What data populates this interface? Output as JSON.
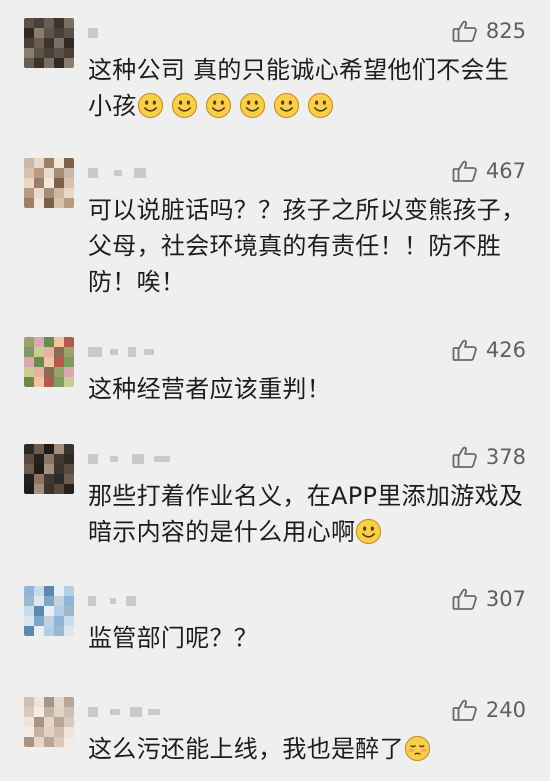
{
  "comments": [
    {
      "likes": "825",
      "text": "这种公司 真的只能诚心希望他们不会生小孩",
      "emojis": [
        "smile",
        "smile",
        "smile",
        "smile",
        "smile",
        "smile"
      ],
      "avatar_colors": [
        "#5a5248",
        "#4a3f34",
        "#6a5e52",
        "#3c332b",
        "#7b6f63",
        "#2f2a25",
        "#8a7d70",
        "#5e5348",
        "#47403a"
      ]
    },
    {
      "likes": "467",
      "text": "可以说脏话吗？？孩子之所以变熊孩子，父母，社会环境真的有责任！！防不胜防！唉！",
      "emojis": [],
      "avatar_colors": [
        "#c9b8a8",
        "#e7d8c8",
        "#9c7f69",
        "#f1e6da",
        "#7d6048",
        "#d8c2ac",
        "#b79a80",
        "#e9dbcc",
        "#a48c77"
      ]
    },
    {
      "likes": "426",
      "text": "这种经营者应该重判！",
      "emojis": [],
      "avatar_colors": [
        "#9aa36c",
        "#d9a9b1",
        "#6d8a4e",
        "#f0c5a2",
        "#b35a4c",
        "#7e9b63",
        "#c9cf8f",
        "#e6b3a0",
        "#8c6b54"
      ]
    },
    {
      "likes": "378",
      "text": "那些打着作业名义，在APP里添加游戏及暗示内容的是什么用心啊",
      "emojis": [
        "smile"
      ],
      "avatar_colors": [
        "#2e2a26",
        "#6d5b4d",
        "#1f1c19",
        "#a38f7c",
        "#3b332c",
        "#5a4b3e",
        "#25211d",
        "#8b7665",
        "#413831"
      ]
    },
    {
      "likes": "307",
      "text": "监管部门呢？？",
      "emojis": [],
      "avatar_colors": [
        "#8fb6d8",
        "#c7dced",
        "#5c88b0",
        "#e8eef4",
        "#b4cfe4",
        "#9bb9cf",
        "#dfe7ee",
        "#7ea7c9",
        "#c2d3df"
      ]
    },
    {
      "likes": "240",
      "text": "这么污还能上线，我也是醉了",
      "emojis": [
        "drunk"
      ],
      "avatar_colors": [
        "#cdbfb3",
        "#efe4da",
        "#a99383",
        "#e4d6ca",
        "#bba695",
        "#d9cabd",
        "#f3ebe4",
        "#c4b2a3",
        "#e0d2c5"
      ]
    }
  ],
  "colors": {
    "background": "#efefef",
    "text": "#1d1d1d",
    "like_count": "#5f5f5f",
    "name_blur": "#c9c9c9",
    "emoji_face": "#f7cf4a",
    "emoji_outline": "#c8912a"
  },
  "icons": {
    "like": "thumbs-up-icon",
    "smile": "smiling-face-icon",
    "drunk": "tipsy-face-icon"
  }
}
